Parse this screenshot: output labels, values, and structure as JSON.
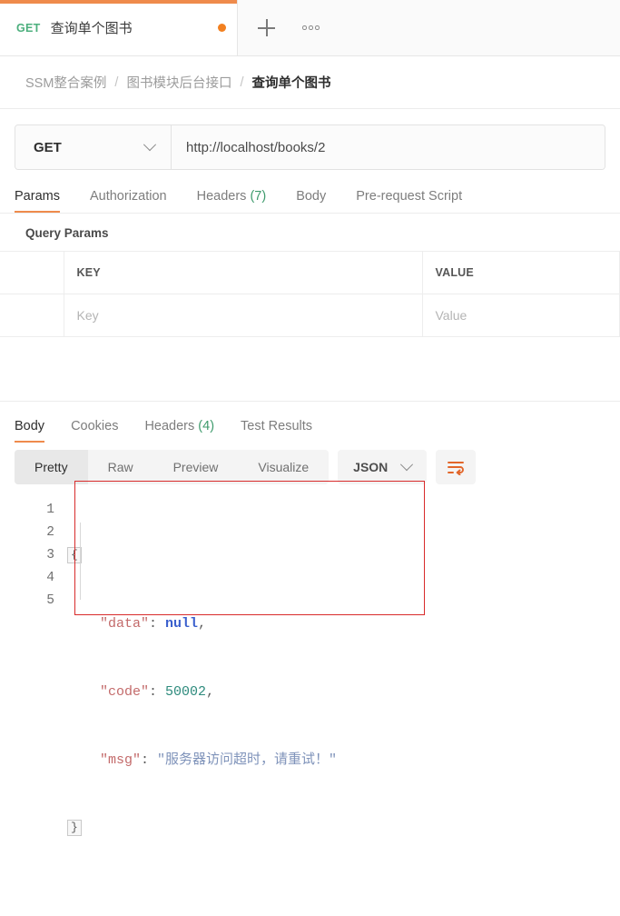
{
  "tab": {
    "method": "GET",
    "title": "查询单个图书",
    "unsaved_dot": true,
    "add_icon": "plus-icon",
    "more_icon": "dots-icon"
  },
  "breadcrumb": {
    "items": [
      "SSM整合案例",
      "图书模块后台接口",
      "查询单个图书"
    ],
    "separator": "/"
  },
  "request": {
    "method": "GET",
    "url": "http://localhost/books/2",
    "method_dropdown_icon": "chevron-down-icon",
    "tabs": [
      {
        "label": "Params",
        "count": "",
        "active": true
      },
      {
        "label": "Authorization",
        "count": "",
        "active": false
      },
      {
        "label": "Headers",
        "count": "(7)",
        "active": false
      },
      {
        "label": "Body",
        "count": "",
        "active": false
      },
      {
        "label": "Pre-request Script",
        "count": "",
        "active": false
      }
    ]
  },
  "query_params": {
    "section_title": "Query Params",
    "columns": [
      "",
      "KEY",
      "VALUE"
    ],
    "rows": [
      {
        "key_placeholder": "Key",
        "value_placeholder": "Value"
      }
    ]
  },
  "response": {
    "tabs": [
      {
        "label": "Body",
        "count": "",
        "active": true
      },
      {
        "label": "Cookies",
        "count": "",
        "active": false
      },
      {
        "label": "Headers",
        "count": "(4)",
        "active": false
      },
      {
        "label": "Test Results",
        "count": "",
        "active": false
      }
    ],
    "view_modes": [
      {
        "label": "Pretty",
        "active": true
      },
      {
        "label": "Raw",
        "active": false
      },
      {
        "label": "Preview",
        "active": false
      },
      {
        "label": "Visualize",
        "active": false
      }
    ],
    "format": "JSON",
    "format_dropdown_icon": "chevron-down-icon",
    "wrap_icon": "text-wrap-icon",
    "body": {
      "line_numbers": [
        "1",
        "2",
        "3",
        "4",
        "5"
      ],
      "open_brace": "{",
      "close_brace": "}",
      "entries": [
        {
          "key": "\"data\"",
          "colon": ":",
          "value": "null",
          "value_type": "null",
          "comma": ","
        },
        {
          "key": "\"code\"",
          "colon": ":",
          "value": "50002",
          "value_type": "number",
          "comma": ","
        },
        {
          "key": "\"msg\"",
          "colon": ":",
          "value": "\"服务器访问超时，请重试！\"",
          "value_type": "string",
          "comma": ""
        }
      ]
    },
    "annotation": {
      "shape": "rectangle",
      "color": "#d82b2b"
    }
  },
  "colors": {
    "accent": "#ef8b4c",
    "method_get": "#4caf7d",
    "count_badge": "#3f9b6d",
    "annotation_red": "#d82b2b",
    "json_key": "#c36a6a",
    "json_null": "#3a5fcd",
    "json_number": "#2e8b7d",
    "json_string": "#7f93ba"
  }
}
